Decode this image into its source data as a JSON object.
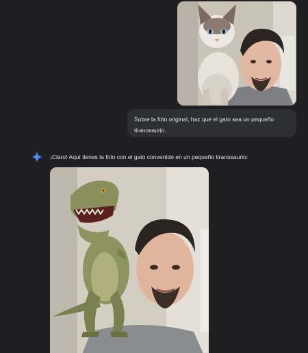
{
  "conversation": {
    "user_message": "Sobre la foto original, haz que el gato sea un pequeño tiranosaurio.",
    "assistant_message": "¡Claro! Aquí tienes la foto con el gato convertido en un pequeño tiranosaurio:"
  },
  "images": {
    "uploaded": {
      "subject": "cat on man's shoulder"
    },
    "generated": {
      "subject": "small tyrannosaurus on man's shoulder"
    }
  },
  "icons": {
    "assistant_avatar": "sparkle-icon"
  },
  "colors": {
    "background": "#1f1f22",
    "bubble": "#2e2f33",
    "text": "#e3e3e3",
    "sparkle": "#4c8df6"
  }
}
